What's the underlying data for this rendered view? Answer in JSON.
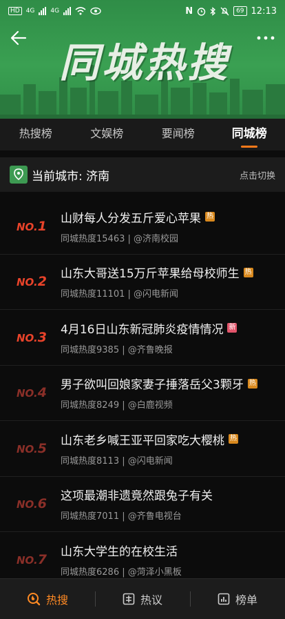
{
  "status_bar": {
    "time": "12:13",
    "battery": "69",
    "hd1": "HD",
    "hd2": "HD",
    "net1": "4G",
    "net2": "4G"
  },
  "banner": {
    "title": "同城热搜"
  },
  "tabs": [
    {
      "label": "热搜榜"
    },
    {
      "label": "文娱榜"
    },
    {
      "label": "要闻榜"
    },
    {
      "label": "同城榜"
    }
  ],
  "city": {
    "label": "当前城市: 济南",
    "switch": "点击切换"
  },
  "colors": {
    "accent": "#ff7a1a",
    "banner_green": "#3aa052",
    "hot": "#d9891e",
    "new": "#e2556b"
  },
  "items": [
    {
      "rank_prefix": "NO.",
      "rank": "1",
      "title": "山财每人分发五斤爱心苹果",
      "badge": "热",
      "heat": "同城热度15463",
      "source": "| @济南校园",
      "rank_color": "#e8432a",
      "badge_color": "#d9891e"
    },
    {
      "rank_prefix": "NO.",
      "rank": "2",
      "title": "山东大哥送15万斤苹果给母校师生",
      "badge": "热",
      "heat": "同城热度11101",
      "source": "| @闪电新闻",
      "rank_color": "#e8432a",
      "badge_color": "#d9891e"
    },
    {
      "rank_prefix": "NO.",
      "rank": "3",
      "title": "4月16日山东新冠肺炎疫情情况",
      "badge": "新",
      "heat": "同城热度9385",
      "source": "| @齐鲁晚报",
      "rank_color": "#e8432a",
      "badge_color": "#e2556b"
    },
    {
      "rank_prefix": "NO.",
      "rank": "4",
      "title": "男子欲叫回娘家妻子捶落岳父3颗牙",
      "badge": "热",
      "heat": "同城热度8249",
      "source": "| @白鹿视频",
      "rank_color": "#8a2f28",
      "badge_color": "#d9891e"
    },
    {
      "rank_prefix": "NO.",
      "rank": "5",
      "title": "山东老乡喊王亚平回家吃大樱桃",
      "badge": "热",
      "heat": "同城热度8113",
      "source": "| @闪电新闻",
      "rank_color": "#8a2f28",
      "badge_color": "#d9891e"
    },
    {
      "rank_prefix": "NO.",
      "rank": "6",
      "title": "这项最潮非遗竟然跟兔子有关",
      "badge": "",
      "heat": "同城热度7011",
      "source": "| @齐鲁电视台",
      "rank_color": "#8a2f28",
      "badge_color": ""
    },
    {
      "rank_prefix": "NO.",
      "rank": "7",
      "title": "山东大学生的在校生活",
      "badge": "",
      "heat": "同城热度6286",
      "source": "| @菏泽小黑板",
      "rank_color": "#8a2f28",
      "badge_color": ""
    }
  ],
  "bottom_nav": [
    {
      "label": "热搜",
      "icon": "search-flame-icon"
    },
    {
      "label": "热议",
      "icon": "discussion-icon"
    },
    {
      "label": "榜单",
      "icon": "chart-list-icon"
    }
  ]
}
